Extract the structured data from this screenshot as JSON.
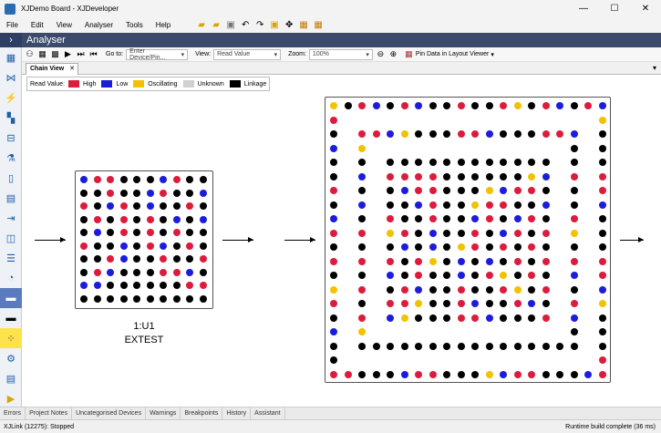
{
  "window": {
    "title": "XJDemo Board - XJDeveloper",
    "min": "—",
    "max": "☐",
    "close": "✕"
  },
  "menu": [
    "File",
    "Edit",
    "View",
    "Analyser",
    "Tools",
    "Help"
  ],
  "panel": {
    "title": "Analyser"
  },
  "toolbar": {
    "goto_label": "Go to:",
    "goto_placeholder": "Enter Device/Pin...",
    "view_label": "View:",
    "view_value": "Read Value",
    "zoom_label": "Zoom:",
    "zoom_value": "100%",
    "pin_data_label": "Pin Data in Layout Viewer"
  },
  "tab": {
    "label": "Chain View",
    "close": "✕"
  },
  "legend": {
    "title": "Read Value:",
    "items": [
      {
        "label": "High",
        "color": "#dc1c3c"
      },
      {
        "label": "Low",
        "color": "#1c1cdc"
      },
      {
        "label": "Oscillating",
        "color": "#f2c200"
      },
      {
        "label": "Unknown",
        "color": "#d0d0d0"
      },
      {
        "label": "Linkage",
        "color": "#000000"
      }
    ]
  },
  "device1": {
    "name": "1:U1",
    "mode": "EXTEST"
  },
  "bottom_tabs": [
    "Errors",
    "Project Notes",
    "Uncategorised Devices",
    "Warnings",
    "Breakpoints",
    "History",
    "Assistant"
  ],
  "status": {
    "left": "XJLink (12275): Stopped",
    "right": "Runtime build complete (36 ms)"
  },
  "colors": {
    "high": "#dc1c3c",
    "low": "#1c1cdc",
    "osc": "#f2c200",
    "link": "#000000",
    "header": "#3b4a6b"
  }
}
